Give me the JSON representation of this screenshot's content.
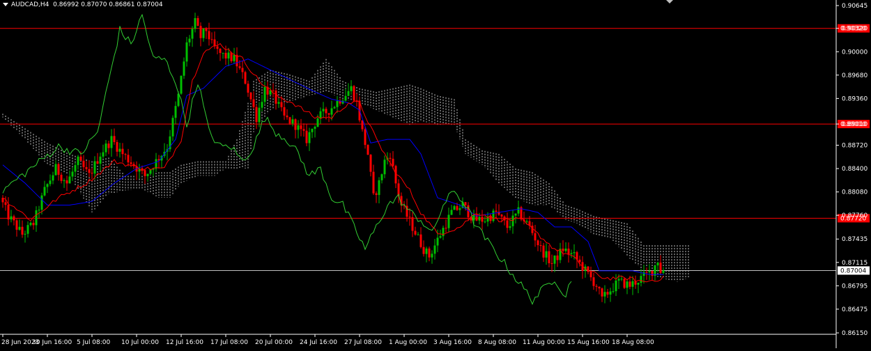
{
  "header": {
    "symbol_tf": "AUDCAD,H4",
    "ohlc": "0.86992 0.87070 0.86861 0.87004"
  },
  "colors": {
    "background": "#000000",
    "bull": "#00c000",
    "bear": "#ff0000",
    "tenkan": "#ff0000",
    "kijun": "#0000ff",
    "chikou": "#32cd32",
    "cloud": "#ffffff",
    "hline": "#ff0000",
    "price_line": "#c0c0c0"
  },
  "chart_data": {
    "type": "candlestick",
    "ylim": [
      0.8615,
      0.9067
    ],
    "y_ticks": [
      "0.90645",
      "0.90320",
      "0.90000",
      "0.89680",
      "0.89360",
      "0.89010",
      "0.88720",
      "0.88400",
      "0.88080",
      "0.87760",
      "0.87435",
      "0.87115",
      "0.86795",
      "0.86475",
      "0.86150"
    ],
    "y_tick_values": [
      0.90645,
      0.9032,
      0.9,
      0.8968,
      0.8936,
      0.8901,
      0.8872,
      0.884,
      0.8808,
      0.8776,
      0.87435,
      0.87115,
      0.86795,
      0.86475,
      0.8615
    ],
    "x_ticks": [
      "28 Jun 2023",
      "30 Jun 16:00",
      "5 Jul 08:00",
      "10 Jul 00:00",
      "12 Jul 16:00",
      "17 Jul 08:00",
      "20 Jul 00:00",
      "24 Jul 16:00",
      "27 Jul 08:00",
      "1 Aug 00:00",
      "3 Aug 16:00",
      "8 Aug 08:00",
      "11 Aug 00:00",
      "15 Aug 16:00",
      "18 Aug 08:00"
    ],
    "x_tick_bar_index": [
      0,
      16,
      32,
      48,
      64,
      80,
      96,
      112,
      128,
      144,
      160,
      176,
      192,
      208,
      224
    ],
    "horizontal_levels": [
      {
        "value": 0.9032,
        "label": "0.90320"
      },
      {
        "value": 0.8901,
        "label": "0.89010"
      },
      {
        "value": 0.8772,
        "label": "0.87720"
      }
    ],
    "current_price": {
      "value": 0.87004,
      "label": "0.87004"
    },
    "bar_count": 238,
    "price_anchors": [
      [
        0,
        0.88
      ],
      [
        3,
        0.8775
      ],
      [
        8,
        0.875
      ],
      [
        12,
        0.8765
      ],
      [
        16,
        0.881
      ],
      [
        20,
        0.884
      ],
      [
        24,
        0.882
      ],
      [
        28,
        0.885
      ],
      [
        32,
        0.883
      ],
      [
        36,
        0.886
      ],
      [
        40,
        0.888
      ],
      [
        44,
        0.886
      ],
      [
        48,
        0.8845
      ],
      [
        52,
        0.883
      ],
      [
        56,
        0.885
      ],
      [
        60,
        0.887
      ],
      [
        64,
        0.894
      ],
      [
        67,
        0.901
      ],
      [
        70,
        0.904
      ],
      [
        72,
        0.902
      ],
      [
        74,
        0.903
      ],
      [
        76,
        0.901
      ],
      [
        78,
        0.9
      ],
      [
        80,
        0.8995
      ],
      [
        84,
        0.899
      ],
      [
        88,
        0.896
      ],
      [
        92,
        0.891
      ],
      [
        95,
        0.895
      ],
      [
        98,
        0.894
      ],
      [
        102,
        0.891
      ],
      [
        106,
        0.89
      ],
      [
        110,
        0.888
      ],
      [
        114,
        0.891
      ],
      [
        118,
        0.892
      ],
      [
        122,
        0.8935
      ],
      [
        126,
        0.895
      ],
      [
        128,
        0.893
      ],
      [
        130,
        0.889
      ],
      [
        132,
        0.886
      ],
      [
        134,
        0.88
      ],
      [
        136,
        0.882
      ],
      [
        138,
        0.885
      ],
      [
        140,
        0.886
      ],
      [
        142,
        0.882
      ],
      [
        144,
        0.879
      ],
      [
        148,
        0.876
      ],
      [
        152,
        0.873
      ],
      [
        154,
        0.872
      ],
      [
        158,
        0.875
      ],
      [
        162,
        0.878
      ],
      [
        166,
        0.879
      ],
      [
        170,
        0.877
      ],
      [
        174,
        0.877
      ],
      [
        178,
        0.878
      ],
      [
        182,
        0.876
      ],
      [
        186,
        0.878
      ],
      [
        190,
        0.876
      ],
      [
        194,
        0.873
      ],
      [
        198,
        0.871
      ],
      [
        202,
        0.873
      ],
      [
        206,
        0.872
      ],
      [
        210,
        0.87
      ],
      [
        214,
        0.868
      ],
      [
        216,
        0.866
      ],
      [
        218,
        0.867
      ],
      [
        222,
        0.8685
      ],
      [
        226,
        0.868
      ],
      [
        230,
        0.869
      ],
      [
        234,
        0.87
      ],
      [
        236,
        0.8715
      ],
      [
        237,
        0.87004
      ]
    ],
    "tenkan_anchors": [
      [
        0,
        0.88
      ],
      [
        10,
        0.877
      ],
      [
        20,
        0.88
      ],
      [
        30,
        0.882
      ],
      [
        40,
        0.885
      ],
      [
        50,
        0.884
      ],
      [
        58,
        0.884
      ],
      [
        64,
        0.888
      ],
      [
        68,
        0.896
      ],
      [
        72,
        0.9
      ],
      [
        78,
        0.901
      ],
      [
        86,
        0.899
      ],
      [
        92,
        0.896
      ],
      [
        98,
        0.894
      ],
      [
        104,
        0.893
      ],
      [
        112,
        0.891
      ],
      [
        118,
        0.891
      ],
      [
        124,
        0.893
      ],
      [
        128,
        0.893
      ],
      [
        134,
        0.888
      ],
      [
        140,
        0.884
      ],
      [
        146,
        0.881
      ],
      [
        150,
        0.878
      ],
      [
        156,
        0.875
      ],
      [
        164,
        0.876
      ],
      [
        170,
        0.878
      ],
      [
        178,
        0.877
      ],
      [
        186,
        0.877
      ],
      [
        192,
        0.875
      ],
      [
        198,
        0.873
      ],
      [
        204,
        0.872
      ],
      [
        210,
        0.87
      ],
      [
        216,
        0.869
      ],
      [
        224,
        0.869
      ],
      [
        230,
        0.8685
      ],
      [
        237,
        0.869
      ]
    ],
    "kijun_anchors": [
      [
        0,
        0.8845
      ],
      [
        8,
        0.882
      ],
      [
        16,
        0.879
      ],
      [
        24,
        0.879
      ],
      [
        32,
        0.8795
      ],
      [
        40,
        0.882
      ],
      [
        48,
        0.884
      ],
      [
        56,
        0.885
      ],
      [
        62,
        0.888
      ],
      [
        66,
        0.894
      ],
      [
        72,
        0.895
      ],
      [
        80,
        0.898
      ],
      [
        88,
        0.899
      ],
      [
        96,
        0.8975
      ],
      [
        104,
        0.896
      ],
      [
        112,
        0.8945
      ],
      [
        118,
        0.8935
      ],
      [
        124,
        0.893
      ],
      [
        128,
        0.892
      ],
      [
        132,
        0.8875
      ],
      [
        138,
        0.888
      ],
      [
        146,
        0.888
      ],
      [
        150,
        0.886
      ],
      [
        156,
        0.88
      ],
      [
        164,
        0.879
      ],
      [
        170,
        0.8775
      ],
      [
        178,
        0.878
      ],
      [
        186,
        0.8785
      ],
      [
        192,
        0.878
      ],
      [
        198,
        0.876
      ],
      [
        204,
        0.876
      ],
      [
        210,
        0.874
      ],
      [
        214,
        0.87
      ],
      [
        220,
        0.87
      ],
      [
        226,
        0.87
      ],
      [
        232,
        0.8695
      ],
      [
        237,
        0.8695
      ]
    ],
    "chikou_anchors": [
      [
        0,
        0.881
      ],
      [
        10,
        0.884
      ],
      [
        20,
        0.887
      ],
      [
        28,
        0.886
      ],
      [
        34,
        0.889
      ],
      [
        38,
        0.896
      ],
      [
        42,
        0.903
      ],
      [
        46,
        0.901
      ],
      [
        50,
        0.905
      ],
      [
        54,
        0.899
      ],
      [
        58,
        0.899
      ],
      [
        62,
        0.896
      ],
      [
        66,
        0.89
      ],
      [
        70,
        0.896
      ],
      [
        74,
        0.889
      ],
      [
        78,
        0.887
      ],
      [
        82,
        0.887
      ],
      [
        86,
        0.885
      ],
      [
        90,
        0.887
      ],
      [
        94,
        0.891
      ],
      [
        98,
        0.889
      ],
      [
        102,
        0.888
      ],
      [
        106,
        0.886
      ],
      [
        110,
        0.883
      ],
      [
        114,
        0.884
      ],
      [
        118,
        0.88
      ],
      [
        122,
        0.879
      ],
      [
        126,
        0.876
      ],
      [
        130,
        0.873
      ],
      [
        134,
        0.876
      ],
      [
        138,
        0.879
      ],
      [
        142,
        0.88
      ],
      [
        146,
        0.878
      ],
      [
        150,
        0.877
      ],
      [
        154,
        0.875
      ],
      [
        158,
        0.879
      ],
      [
        162,
        0.881
      ],
      [
        166,
        0.879
      ],
      [
        170,
        0.876
      ],
      [
        174,
        0.874
      ],
      [
        178,
        0.872
      ],
      [
        182,
        0.87
      ],
      [
        186,
        0.868
      ],
      [
        190,
        0.866
      ],
      [
        194,
        0.8675
      ],
      [
        198,
        0.869
      ],
      [
        202,
        0.8665
      ],
      [
        204,
        0.869
      ]
    ],
    "cloud_anchors": [
      [
        0,
        0.8915,
        0.891
      ],
      [
        8,
        0.8895,
        0.888
      ],
      [
        16,
        0.8875,
        0.8845
      ],
      [
        24,
        0.886,
        0.883
      ],
      [
        32,
        0.885,
        0.878
      ],
      [
        38,
        0.8855,
        0.8805
      ],
      [
        44,
        0.883,
        0.881
      ],
      [
        50,
        0.883,
        0.8812
      ],
      [
        56,
        0.8835,
        0.88
      ],
      [
        60,
        0.8835,
        0.88
      ],
      [
        64,
        0.8845,
        0.882
      ],
      [
        70,
        0.885,
        0.883
      ],
      [
        76,
        0.885,
        0.883
      ],
      [
        80,
        0.885,
        0.884
      ],
      [
        84,
        0.888,
        0.884
      ],
      [
        88,
        0.893,
        0.884
      ],
      [
        90,
        0.896,
        0.889
      ],
      [
        96,
        0.8975,
        0.892
      ],
      [
        102,
        0.897,
        0.893
      ],
      [
        110,
        0.896,
        0.894
      ],
      [
        116,
        0.899,
        0.8945
      ],
      [
        122,
        0.896,
        0.8935
      ],
      [
        128,
        0.895,
        0.893
      ],
      [
        134,
        0.8945,
        0.892
      ],
      [
        140,
        0.895,
        0.891
      ],
      [
        146,
        0.8955,
        0.89
      ],
      [
        150,
        0.895,
        0.8905
      ],
      [
        156,
        0.894,
        0.89
      ],
      [
        162,
        0.8935,
        0.89
      ],
      [
        166,
        0.888,
        0.886
      ],
      [
        172,
        0.8865,
        0.8845
      ],
      [
        178,
        0.886,
        0.882
      ],
      [
        184,
        0.884,
        0.88
      ],
      [
        190,
        0.8835,
        0.879
      ],
      [
        196,
        0.882,
        0.879
      ],
      [
        202,
        0.879,
        0.877
      ],
      [
        206,
        0.8785,
        0.8765
      ],
      [
        212,
        0.8775,
        0.875
      ],
      [
        218,
        0.877,
        0.8745
      ],
      [
        224,
        0.8765,
        0.872
      ],
      [
        230,
        0.8735,
        0.87
      ],
      [
        236,
        0.8735,
        0.869
      ],
      [
        242,
        0.8735,
        0.8685
      ],
      [
        246,
        0.8735,
        0.869
      ]
    ],
    "cloud_extends_bars": 246
  }
}
